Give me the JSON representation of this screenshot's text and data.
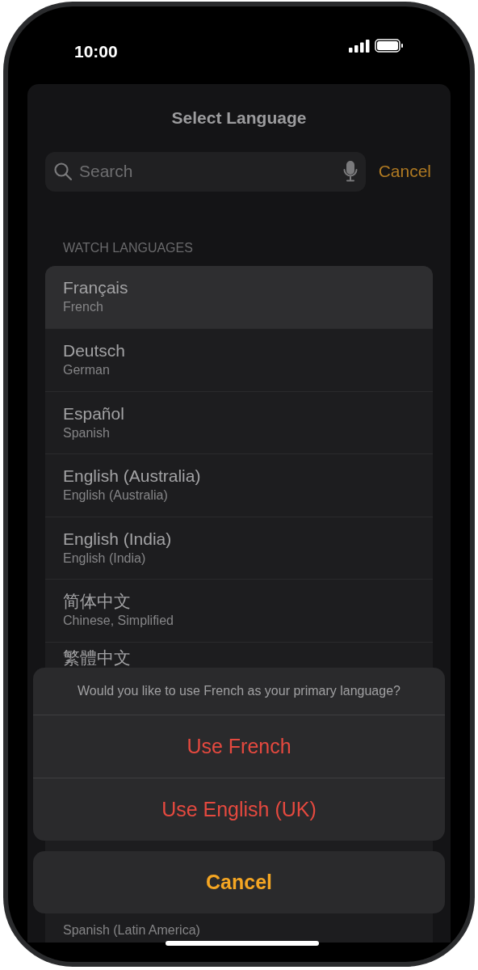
{
  "status_bar": {
    "time": "10:00"
  },
  "sheet": {
    "title": "Select Language",
    "search": {
      "placeholder": "Search"
    },
    "cancel": "Cancel"
  },
  "section_header": "WATCH LANGUAGES",
  "languages": [
    {
      "name": "Français",
      "subtitle": "French",
      "selected": true
    },
    {
      "name": "Deutsch",
      "subtitle": "German",
      "selected": false
    },
    {
      "name": "Español",
      "subtitle": "Spanish",
      "selected": false
    },
    {
      "name": "English (Australia)",
      "subtitle": "English (Australia)",
      "selected": false
    },
    {
      "name": "English (India)",
      "subtitle": "English (India)",
      "selected": false
    },
    {
      "name": "简体中文",
      "subtitle": "Chinese, Simplified",
      "selected": false
    },
    {
      "name": "繁體中文",
      "selected": false
    }
  ],
  "last_language": {
    "subtitle": "Spanish (Latin America)"
  },
  "action_sheet": {
    "message": "Would you like to use French as your primary language?",
    "actions": [
      "Use French",
      "Use English (UK)"
    ],
    "cancel": "Cancel"
  }
}
